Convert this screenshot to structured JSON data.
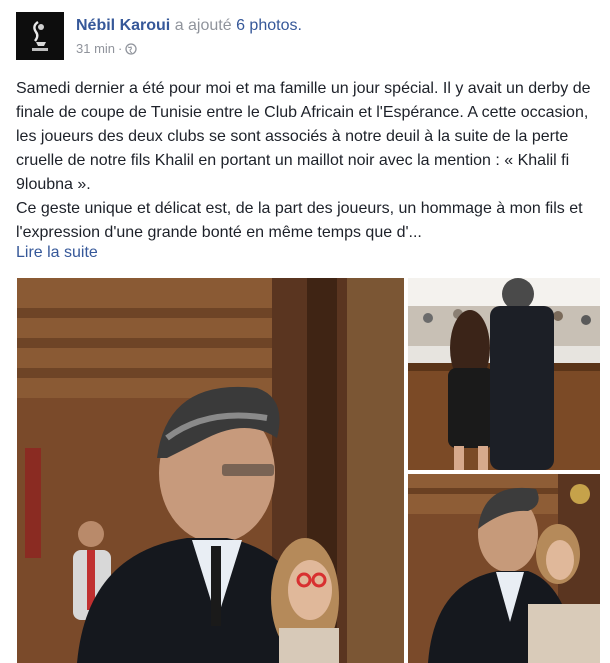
{
  "post": {
    "author": "Nébil Karoui",
    "action": "a ajouté",
    "photo_count": "6 photos.",
    "time": "31 min",
    "separator": "·",
    "audience_icon": "globe-icon",
    "text_paragraph_1": "Samedi dernier a été pour moi et ma famille un jour spécial. Il y avait un derby de finale de coupe de Tunisie entre le Club Africain et l'Espérance. A cette occasion, les joueurs des deux clubs se sont associés à notre deuil à la suite de la perte cruelle de notre fils Khalil en portant un maillot noir avec la mention : « Khalil fi 9loubna ».",
    "text_paragraph_2": "Ce geste unique et délicat est, de la part des joueurs, un hommage à mon fils et l'expression d'une grande bonté en même temps que d'...",
    "see_more": "Lire la suite"
  },
  "colors": {
    "link": "#365899",
    "text": "#1d2129",
    "meta": "#90949c"
  }
}
